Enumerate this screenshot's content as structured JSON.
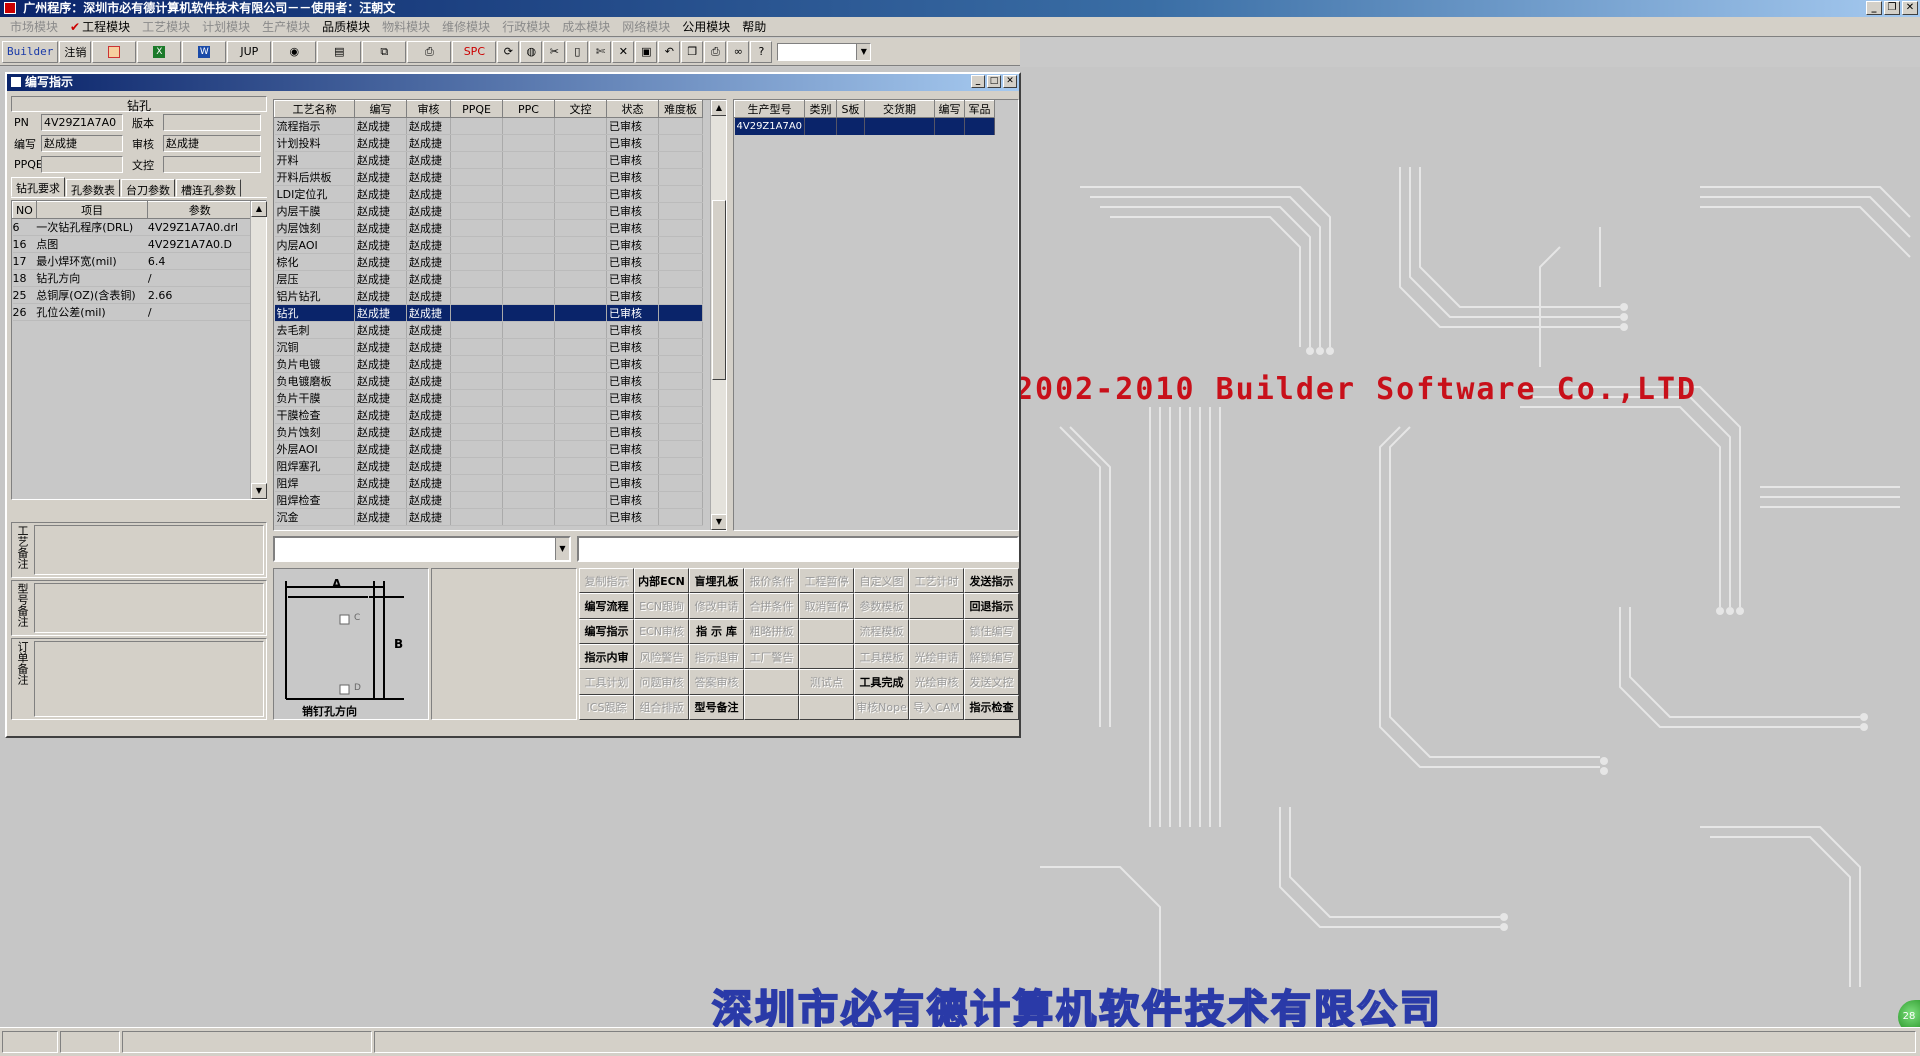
{
  "app": {
    "title": "广州程序：深圳市必有德计算机软件技术有限公司－－使用者：汪朝文"
  },
  "menu": [
    "市场模块",
    "工程模块",
    "工艺模块",
    "计划模块",
    "生产模块",
    "品质模块",
    "物料模块",
    "维修模块",
    "行政模块",
    "成本模块",
    "网络模块",
    "公用模块",
    "帮助"
  ],
  "menu_active": "工程模块",
  "toolbar": {
    "builder": "Builder",
    "logout": "注销",
    "jup": "JUP",
    "spc": "SPC"
  },
  "window": {
    "title": "编写指示"
  },
  "left": {
    "header": "钻孔",
    "pn_label": "PN",
    "pn_value": "4V29Z1A7A0",
    "version_label": "版本",
    "version_value": "",
    "writer_label": "编写",
    "writer_value": "赵成捷",
    "reviewer_label": "审核",
    "reviewer_value": "赵成捷",
    "ppqe_label": "PPQE",
    "ppqe_value": "",
    "control_label": "文控",
    "control_value": ""
  },
  "tabs": [
    "钻孔要求",
    "孔参数表",
    "台刀参数",
    "槽连孔参数"
  ],
  "params": {
    "headers": [
      "NO",
      "项目",
      "参数"
    ],
    "rows": [
      [
        "6",
        "一次钻孔程序(DRL)",
        "4V29Z1A7A0.drl"
      ],
      [
        "16",
        "点图",
        "4V29Z1A7A0.D"
      ],
      [
        "17",
        "最小焊环宽(mil)",
        "6.4"
      ],
      [
        "18",
        "钻孔方向",
        "/"
      ],
      [
        "25",
        "总铜厚(OZ)(含表铜)",
        "2.66"
      ],
      [
        "26",
        "孔位公差(mil)",
        "/"
      ]
    ]
  },
  "notes": {
    "craft": "工艺备注",
    "model": "型号备注",
    "order": "订单备注"
  },
  "process": {
    "headers": [
      "工艺名称",
      "编写",
      "审核",
      "PPQE",
      "PPC",
      "文控",
      "状态",
      "难度板"
    ],
    "rows": [
      [
        "流程指示",
        "赵成捷",
        "赵成捷",
        "",
        "",
        "",
        "已审核",
        ""
      ],
      [
        "计划投料",
        "赵成捷",
        "赵成捷",
        "",
        "",
        "",
        "已审核",
        ""
      ],
      [
        "开料",
        "赵成捷",
        "赵成捷",
        "",
        "",
        "",
        "已审核",
        ""
      ],
      [
        "开料后烘板",
        "赵成捷",
        "赵成捷",
        "",
        "",
        "",
        "已审核",
        ""
      ],
      [
        "LDI定位孔",
        "赵成捷",
        "赵成捷",
        "",
        "",
        "",
        "已审核",
        ""
      ],
      [
        "内层干膜",
        "赵成捷",
        "赵成捷",
        "",
        "",
        "",
        "已审核",
        ""
      ],
      [
        "内层蚀刻",
        "赵成捷",
        "赵成捷",
        "",
        "",
        "",
        "已审核",
        ""
      ],
      [
        "内层AOI",
        "赵成捷",
        "赵成捷",
        "",
        "",
        "",
        "已审核",
        ""
      ],
      [
        "棕化",
        "赵成捷",
        "赵成捷",
        "",
        "",
        "",
        "已审核",
        ""
      ],
      [
        "层压",
        "赵成捷",
        "赵成捷",
        "",
        "",
        "",
        "已审核",
        ""
      ],
      [
        "铝片钻孔",
        "赵成捷",
        "赵成捷",
        "",
        "",
        "",
        "已审核",
        ""
      ],
      [
        "钻孔",
        "赵成捷",
        "赵成捷",
        "",
        "",
        "",
        "已审核",
        ""
      ],
      [
        "去毛刺",
        "赵成捷",
        "赵成捷",
        "",
        "",
        "",
        "已审核",
        ""
      ],
      [
        "沉铜",
        "赵成捷",
        "赵成捷",
        "",
        "",
        "",
        "已审核",
        ""
      ],
      [
        "负片电镀",
        "赵成捷",
        "赵成捷",
        "",
        "",
        "",
        "已审核",
        ""
      ],
      [
        "负电镀磨板",
        "赵成捷",
        "赵成捷",
        "",
        "",
        "",
        "已审核",
        ""
      ],
      [
        "负片干膜",
        "赵成捷",
        "赵成捷",
        "",
        "",
        "",
        "已审核",
        ""
      ],
      [
        "干膜检查",
        "赵成捷",
        "赵成捷",
        "",
        "",
        "",
        "已审核",
        ""
      ],
      [
        "负片蚀刻",
        "赵成捷",
        "赵成捷",
        "",
        "",
        "",
        "已审核",
        ""
      ],
      [
        "外层AOI",
        "赵成捷",
        "赵成捷",
        "",
        "",
        "",
        "已审核",
        ""
      ],
      [
        "阻焊塞孔",
        "赵成捷",
        "赵成捷",
        "",
        "",
        "",
        "已审核",
        ""
      ],
      [
        "阻焊",
        "赵成捷",
        "赵成捷",
        "",
        "",
        "",
        "已审核",
        ""
      ],
      [
        "阻焊检查",
        "赵成捷",
        "赵成捷",
        "",
        "",
        "",
        "已审核",
        ""
      ],
      [
        "沉金",
        "赵成捷",
        "赵成捷",
        "",
        "",
        "",
        "已审核",
        ""
      ]
    ],
    "selected": "钻孔"
  },
  "orders": {
    "headers": [
      "生产型号",
      "类别",
      "S板",
      "交货期",
      "编写",
      "军品"
    ],
    "rows": [
      [
        "4V29Z1A7A0",
        "",
        "",
        "",
        "",
        ""
      ]
    ]
  },
  "diagram": {
    "a": "A",
    "b": "B",
    "c": "C",
    "d": "D",
    "caption": "销钉孔方向"
  },
  "buttons": [
    [
      "复制指示",
      "内部ECN",
      "盲埋孔板",
      "报价条件",
      "工程暂停",
      "自定义图",
      "工艺计时",
      "发送指示"
    ],
    [
      "编写流程",
      "ECN跟询",
      "修改申请",
      "合拼条件",
      "取消暂停",
      "参数模板",
      "",
      "回退指示"
    ],
    [
      "编写指示",
      "ECN审核",
      "指 示 库",
      "粗略拼板",
      "",
      "流程模板",
      "",
      "锁住编写"
    ],
    [
      "指示内审",
      "风险警告",
      "指示退审",
      "工厂警告",
      "",
      "工具模板",
      "光绘申请",
      "解锁编写"
    ],
    [
      "工具计划",
      "问题审核",
      "答案审核",
      "",
      "测试点",
      "工具完成",
      "光绘审核",
      "发送文控"
    ],
    [
      "ICS跟踪",
      "组合排版",
      "型号备注",
      "",
      "",
      "审核Nope",
      "导入CAM",
      "指示检查"
    ]
  ],
  "buttons_enabled": [
    "内部ECN",
    "盲埋孔板",
    "发送指示",
    "编写流程",
    "回退指示",
    "编写指示",
    "指 示 库",
    "指示内审",
    "工具完成",
    "型号备注",
    "指示检查"
  ],
  "brand": {
    "copyright": "2002-2010 Builder Software Co.,LTD",
    "company": "深圳市必有德计算机软件技术有限公司"
  },
  "colors": {
    "title_bar": "#0a246a",
    "selection": "#0a246a",
    "copyright": "#c8101a",
    "company_outline": "#2a3aa8"
  }
}
